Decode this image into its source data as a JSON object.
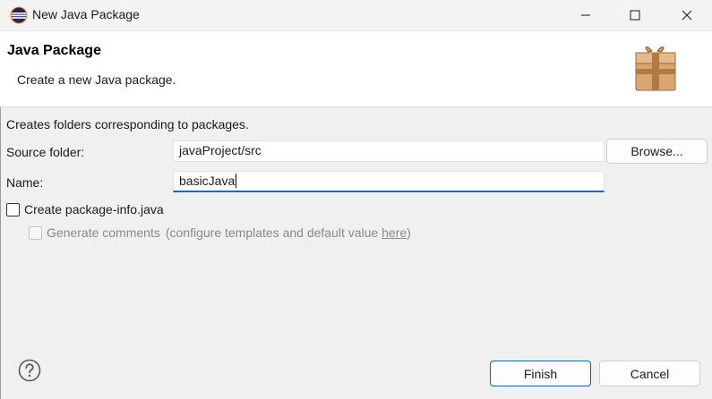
{
  "window": {
    "title": "New Java Package",
    "app_icon": "eclipse-icon",
    "controls": {
      "minimize": "minimize-icon",
      "maximize": "maximize-icon",
      "close": "close-icon"
    }
  },
  "banner": {
    "title": "Java Package",
    "description": "Create a new Java package.",
    "image_icon": "package-wizard-icon"
  },
  "form": {
    "intro": "Creates folders corresponding to packages.",
    "source_folder_label": "Source folder:",
    "source_folder_value": "javaProject/src",
    "browse_label": "Browse...",
    "name_label": "Name:",
    "name_value": "basicJava",
    "create_info_label": "Create package-info.java",
    "create_info_checked": false,
    "generate_comments_label": "Generate comments",
    "generate_comments_checked": false,
    "generate_comments_enabled": false,
    "generate_hint_prefix": "(configure templates and default value ",
    "generate_hint_link": "here",
    "generate_hint_suffix": ")"
  },
  "footer": {
    "help_icon": "help-icon",
    "finish_label": "Finish",
    "cancel_label": "Cancel"
  },
  "colors": {
    "accent": "#0067c0",
    "background": "#f0f0f0",
    "banner": "#ffffff"
  }
}
